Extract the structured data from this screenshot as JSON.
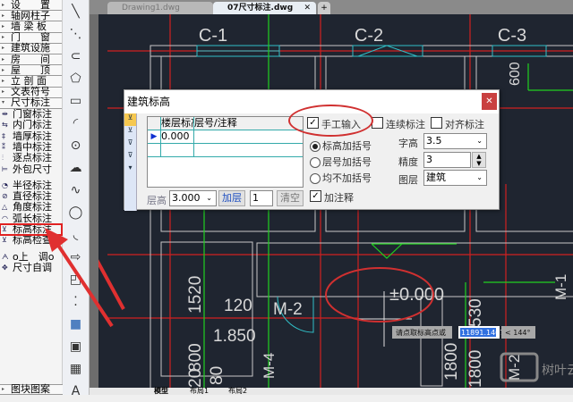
{
  "left_panel": {
    "menus": [
      "设　　置",
      "轴网柱子",
      "墙 梁 板",
      "门　　窗",
      "建筑设施",
      "房　　间",
      "屋　　顶",
      "立 剖 面",
      "文表符号",
      "尺寸标注"
    ],
    "dim_items_1": [
      {
        "icon": "⇹",
        "label": "门窗标注"
      },
      {
        "icon": "⇆",
        "label": "内门标注"
      },
      {
        "icon": "‡",
        "label": "墙厚标注"
      },
      {
        "icon": "⁑",
        "label": "墙中标注"
      },
      {
        "icon": "⫶",
        "label": "逐点标注"
      },
      {
        "icon": "⊨",
        "label": "外包尺寸"
      }
    ],
    "dim_items_2": [
      {
        "icon": "◔",
        "label": "半径标注"
      },
      {
        "icon": "⊘",
        "label": "直径标注"
      },
      {
        "icon": "△",
        "label": "角度标注"
      },
      {
        "icon": "◠",
        "label": "弧长标注"
      },
      {
        "icon": "⊻",
        "label": "标高标注"
      },
      {
        "icon": "⊻",
        "label": "标高检查"
      }
    ],
    "dim_items_3": [
      {
        "icon": "ᗅ",
        "label": "o上　调o"
      },
      {
        "icon": "✥",
        "label": "尺寸自调"
      }
    ],
    "bottom_menu": "图块图案",
    "highlighted": "标高标注"
  },
  "toolbar": {
    "icons": [
      "line-icon",
      "polyline-icon",
      "arc-polyline-icon",
      "pentagon-icon",
      "rectangle-icon",
      "arc-icon",
      "circle-icon",
      "cloud-icon",
      "spline-icon",
      "ellipse-icon",
      "ellipse-arc-icon",
      "insert-block-icon",
      "make-block-icon",
      "point-icon",
      "hatch-icon",
      "region-icon",
      "table-icon",
      "mtext-icon"
    ]
  },
  "file_tabs": [
    {
      "label": "Drawing1.dwg",
      "active": false
    },
    {
      "label": "07尺寸标注.dwg",
      "active": true
    }
  ],
  "layout_tabs": [
    "模型",
    "布局1",
    "布局2"
  ],
  "drawing": {
    "windows": [
      "C-1",
      "C-2",
      "C-3"
    ],
    "doors": [
      "M-2",
      "M-4",
      "M-1",
      "M-2"
    ],
    "dims": [
      "600",
      "1520",
      "120",
      "1.850",
      "800",
      "80",
      "20",
      "1800",
      "530",
      "1800"
    ],
    "elevation": "±0.000",
    "prompt": "请点取标高点或",
    "coord_input": "11891.1467",
    "angle": "< 144°",
    "watermark": "树叶云"
  },
  "dialog": {
    "title": "建筑标高",
    "table": {
      "headers": [
        "楼层标高",
        "层号/注释"
      ],
      "rows": [
        [
          "0.000",
          ""
        ],
        [
          "",
          ""
        ]
      ]
    },
    "manual_input": {
      "label": "手工输入",
      "checked": true
    },
    "continuous": {
      "label": "连续标注",
      "checked": false
    },
    "align": {
      "label": "对齐标注",
      "checked": false
    },
    "bracket_options": [
      {
        "label": "标高加括号",
        "selected": true
      },
      {
        "label": "层号加括号",
        "selected": false
      },
      {
        "label": "均不加括号",
        "selected": false
      }
    ],
    "text_height": {
      "label": "字高",
      "value": "3.5"
    },
    "precision": {
      "label": "精度",
      "value": "3"
    },
    "layer": {
      "label": "图层",
      "value": "建筑"
    },
    "floor_height": {
      "label": "层高",
      "value": "3.000"
    },
    "add_floor": "加层",
    "floor_count": "1",
    "clear": "清空",
    "add_note": {
      "label": "加注释",
      "checked": true
    }
  },
  "colors": {
    "cad_bg": "#1f2530",
    "axis": "#d02020",
    "wall": "#c8c8c8",
    "window": "#30c0c8",
    "dim": "#20d020",
    "annotation": "#d03030"
  }
}
